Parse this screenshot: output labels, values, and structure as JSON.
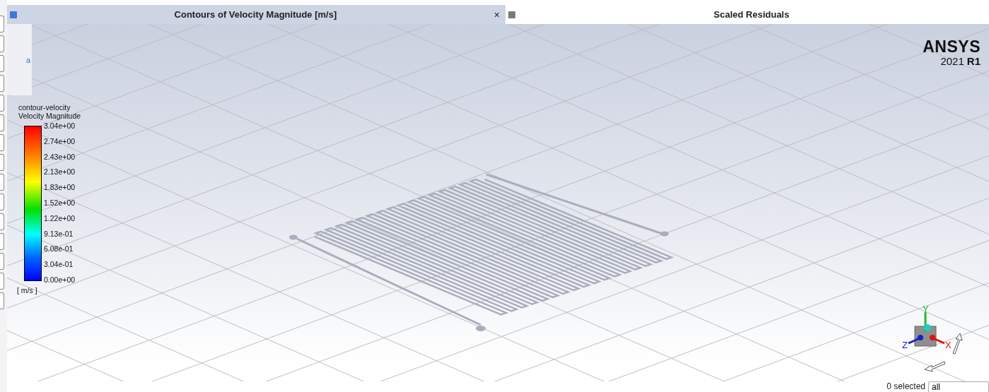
{
  "tabs": [
    {
      "title": "Contours of Velocity Magnitude [m/s]",
      "selected": true,
      "close": "×"
    },
    {
      "title": "Scaled Residuals",
      "selected": false
    }
  ],
  "side_panel": {
    "text": "a"
  },
  "legend": {
    "title": "contour-velocity",
    "quantity": "Velocity Magnitude",
    "unit": "[ m/s ]",
    "ticks": [
      "3.04e+00",
      "2.74e+00",
      "2.43e+00",
      "2.13e+00",
      "1.83e+00",
      "1.52e+00",
      "1.22e+00",
      "9.13e-01",
      "6.08e-01",
      "3.04e-01",
      "0.00e+00"
    ]
  },
  "logo": {
    "name": "ANSYS",
    "year": "2021",
    "release": "R1"
  },
  "triad": {
    "x": "X",
    "y": "Y",
    "z": "Z"
  },
  "status_bar": {
    "selection": "0 selected",
    "filter": "all"
  }
}
